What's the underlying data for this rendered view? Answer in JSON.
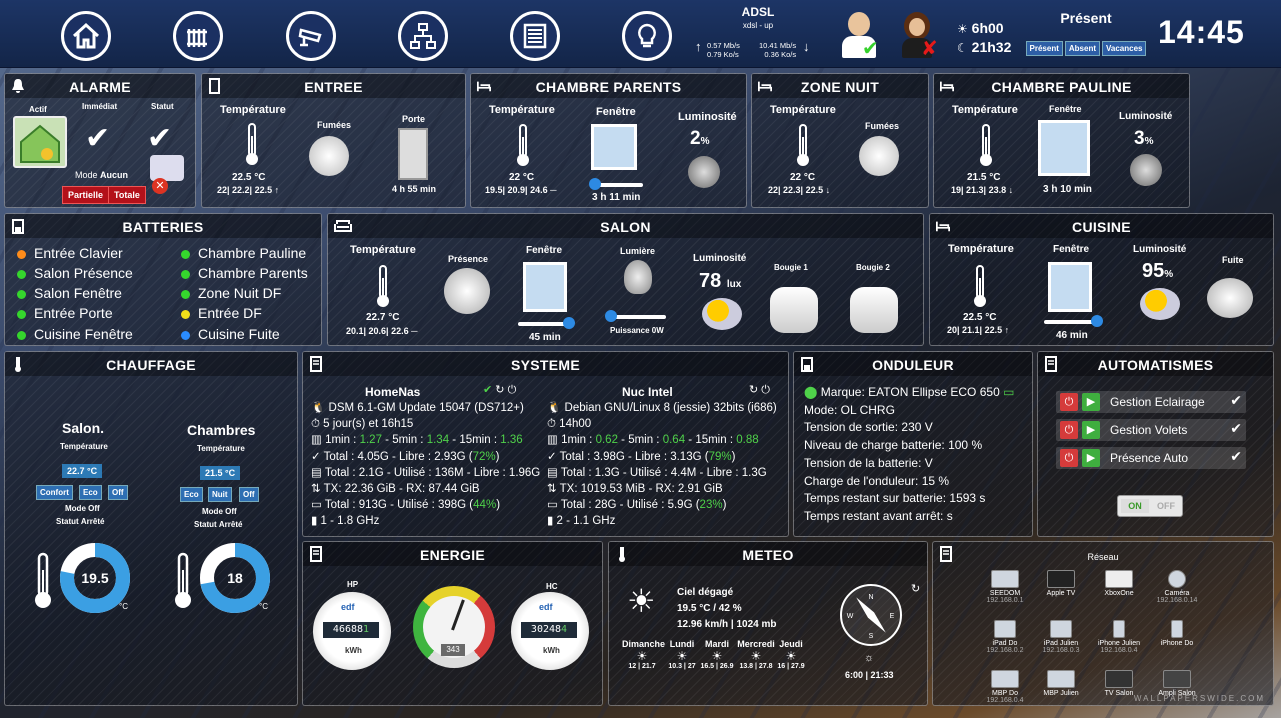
{
  "topbar": {
    "adsl": {
      "title": "ADSL",
      "sub": "xdsl - up",
      "up_rate": "0.57 Mb/s",
      "up_ko": "0.79 Ko/s",
      "down_rate": "10.41 Mb/s",
      "down_ko": "0.36 Ko/s"
    },
    "sun": {
      "sunrise": "6h00",
      "sunset": "21h32"
    },
    "presence": {
      "title": "Présent",
      "buttons": [
        "Présent",
        "Absent",
        "Vacances"
      ]
    },
    "clock": "14:45"
  },
  "alarme": {
    "title": "ALARME",
    "actif": "Actif",
    "immediat": "Immédiat",
    "statut": "Statut",
    "mode_label": "Mode",
    "mode_value": "Aucun",
    "btn_partielle": "Partielle",
    "btn_totale": "Totale"
  },
  "entree": {
    "title": "ENTREE",
    "temp_label": "Température",
    "temp": "22.5 °C",
    "temp_hist": "22| 22.2| 22.5 ↑",
    "fumees": "Fumées",
    "porte": "Porte",
    "porte_time": "4 h 55 min"
  },
  "chambre_parents": {
    "title": "CHAMBRE PARENTS",
    "temp_label": "Température",
    "temp": "22 °C",
    "temp_hist": "19.5| 20.9| 24.6 ─",
    "fenetre": "Fenêtre",
    "fenetre_time": "3 h 11 min",
    "lum_label": "Luminosité",
    "lum": "2",
    "lum_unit": "%"
  },
  "zone_nuit": {
    "title": "ZONE NUIT",
    "temp_label": "Température",
    "temp": "22 °C",
    "temp_hist": "22| 22.3| 22.5 ↓",
    "fumees": "Fumées"
  },
  "chambre_pauline": {
    "title": "CHAMBRE PAULINE",
    "temp_label": "Température",
    "temp": "21.5 °C",
    "temp_hist": "19| 21.3| 23.8 ↓",
    "fenetre": "Fenêtre",
    "fenetre_time": "3 h 10 min",
    "lum_label": "Luminosité",
    "lum": "3",
    "lum_unit": "%"
  },
  "batteries": {
    "title": "BATTERIES",
    "left": [
      {
        "label": "Entrée Clavier",
        "color": "#ff8c1a"
      },
      {
        "label": "Salon Présence",
        "color": "#35d62d"
      },
      {
        "label": "Salon Fenêtre",
        "color": "#35d62d"
      },
      {
        "label": "Entrée Porte",
        "color": "#35d62d"
      },
      {
        "label": "Cuisine Fenêtre",
        "color": "#35d62d"
      }
    ],
    "right": [
      {
        "label": "Chambre Pauline",
        "color": "#35d62d"
      },
      {
        "label": "Chambre Parents",
        "color": "#35d62d"
      },
      {
        "label": "Zone Nuit DF",
        "color": "#35d62d"
      },
      {
        "label": "Entrée DF",
        "color": "#f0e01a"
      },
      {
        "label": "Cuisine Fuite",
        "color": "#2a8cff"
      }
    ]
  },
  "salon": {
    "title": "SALON",
    "temp_label": "Température",
    "temp": "22.7 °C",
    "temp_hist": "20.1| 20.6| 22.6 ─",
    "presence": "Présence",
    "fenetre": "Fenêtre",
    "fenetre_time": "45 min",
    "lumiere": "Lumière",
    "puissance": "Puissance 0W",
    "lum_label": "Luminosité",
    "lum": "78",
    "lum_unit": "lux",
    "bougie1": "Bougie 1",
    "bougie2": "Bougie 2"
  },
  "cuisine": {
    "title": "CUISINE",
    "temp_label": "Température",
    "temp": "22.5 °C",
    "temp_hist": "20| 21.1| 22.5 ↑",
    "fenetre": "Fenêtre",
    "fenetre_time": "46 min",
    "lum_label": "Luminosité",
    "lum": "95",
    "lum_unit": "%",
    "fuite": "Fuite"
  },
  "chauffage": {
    "title": "CHAUFFAGE",
    "salon": {
      "name": "Salon.",
      "temp_label": "Température",
      "temp": "22.7 °C",
      "btns": [
        "Confort",
        "Eco",
        "Off"
      ],
      "mode": "Mode Off",
      "statut_label": "Statut",
      "statut": "Arrêté",
      "gauge": "19.5",
      "unit": "°C",
      "gauge_fraction": 0.78
    },
    "chambres": {
      "name": "Chambres",
      "temp_label": "Température",
      "temp": "21.5 °C",
      "btns": [
        "Eco",
        "Nuit",
        "Off"
      ],
      "mode": "Mode Off",
      "statut_label": "Statut",
      "statut": "Arrêté",
      "gauge": "18",
      "unit": "°C",
      "gauge_fraction": 0.72
    }
  },
  "systeme": {
    "title": "SYSTEME",
    "homenas": {
      "name": "HomeNas",
      "os": "DSM 6.1-GM Update 15047 (DS712+)",
      "uptime": "5 jour(s) et 16h15",
      "load": [
        "1min : ",
        "1.27",
        " - 5min : ",
        "1.34",
        " - 15min : ",
        "1.36"
      ],
      "mem": [
        "Total : 4.05G - Libre : 2.93G (",
        "72%",
        ")"
      ],
      "swap": "Total : 2.1G - Utilisé : 136M - Libre : 1.96G",
      "net": "TX: 22.36 GiB - RX: 87.44 GiB",
      "disk": [
        "Total : 913G - Utilisé : 398G (",
        "44%",
        ")"
      ],
      "cpu": "1 - 1.8 GHz"
    },
    "nuc": {
      "name": "Nuc Intel",
      "os": "Debian GNU/Linux 8 (jessie) 32bits (i686)",
      "uptime": "14h00",
      "load": [
        "1min : ",
        "0.62",
        " - 5min : ",
        "0.64",
        " - 15min : ",
        "0.88"
      ],
      "mem": [
        "Total : 3.98G - Libre : 3.13G (",
        "79%",
        ")"
      ],
      "swap": "Total : 1.3G - Utilisé : 4.4M - Libre : 1.3G",
      "net": "TX: 1019.53 MiB - RX: 2.91 GiB",
      "disk": [
        "Total : 28G - Utilisé : 5.9G (",
        "23%",
        ")"
      ],
      "cpu": "2 - 1.1 GHz"
    }
  },
  "onduleur": {
    "title": "ONDULEUR",
    "lines": [
      "Marque: EATON Ellipse ECO 650",
      "Mode: OL CHRG",
      "Tension de sortie: 230 V",
      "Niveau de charge batterie: 100 %",
      "Tension de la batterie: V",
      "Charge de l'onduleur: 15 %",
      "Temps restant sur batterie: 1593 s",
      "Temps restant avant arrêt: s"
    ]
  },
  "automatismes": {
    "title": "AUTOMATISMES",
    "items": [
      "Gestion Eclairage",
      "Gestion Volets",
      "Présence Auto"
    ],
    "toggle_on": "ON",
    "toggle_off": "OFF"
  },
  "energie": {
    "title": "ENERGIE",
    "hp": "HP",
    "hc": "HC",
    "hp_value": "46688",
    "hp_digit": "1",
    "hc_value": "30248",
    "hc_digit": "4",
    "kwh": "kWh",
    "gauge_value": "343",
    "edf": "edf"
  },
  "meteo": {
    "title": "METEO",
    "cond": "Ciel dégagé",
    "temp": "19.5 °C / 42 %",
    "wind": "12.96 km/h | 1024 mb",
    "days": [
      {
        "name": "Dimanche",
        "range": "12 | 21.7"
      },
      {
        "name": "Lundi",
        "range": "10.3 | 27"
      },
      {
        "name": "Mardi",
        "range": "16.5 | 26.9"
      },
      {
        "name": "Mercredi",
        "range": "13.8 | 27.8"
      },
      {
        "name": "Jeudi",
        "range": "16 | 27.9"
      }
    ],
    "sun": "6:00 | 21:33",
    "compass": {
      "n": "N",
      "s": "S",
      "e": "E",
      "w": "W"
    }
  },
  "reseau": {
    "title": "Réseau",
    "items": [
      {
        "name": "SEEDOM",
        "ip": "192.168.0.1"
      },
      {
        "name": "Apple TV",
        "ip": ""
      },
      {
        "name": "XboxOne",
        "ip": ""
      },
      {
        "name": "Caméra",
        "ip": "192.168.0.14"
      },
      {
        "name": "iPad Do",
        "ip": "192.168.0.2"
      },
      {
        "name": "iPad Julien",
        "ip": "192.168.0.3"
      },
      {
        "name": "iPhone Julien",
        "ip": "192.168.0.4"
      },
      {
        "name": "iPhone Do",
        "ip": ""
      },
      {
        "name": "MBP Do",
        "ip": "192.168.0.4"
      },
      {
        "name": "MBP Julien",
        "ip": ""
      },
      {
        "name": "TV Salon",
        "ip": ""
      },
      {
        "name": "Ampli Salon",
        "ip": ""
      }
    ]
  },
  "watermark": "WALLPAPERSWIDE.COM"
}
